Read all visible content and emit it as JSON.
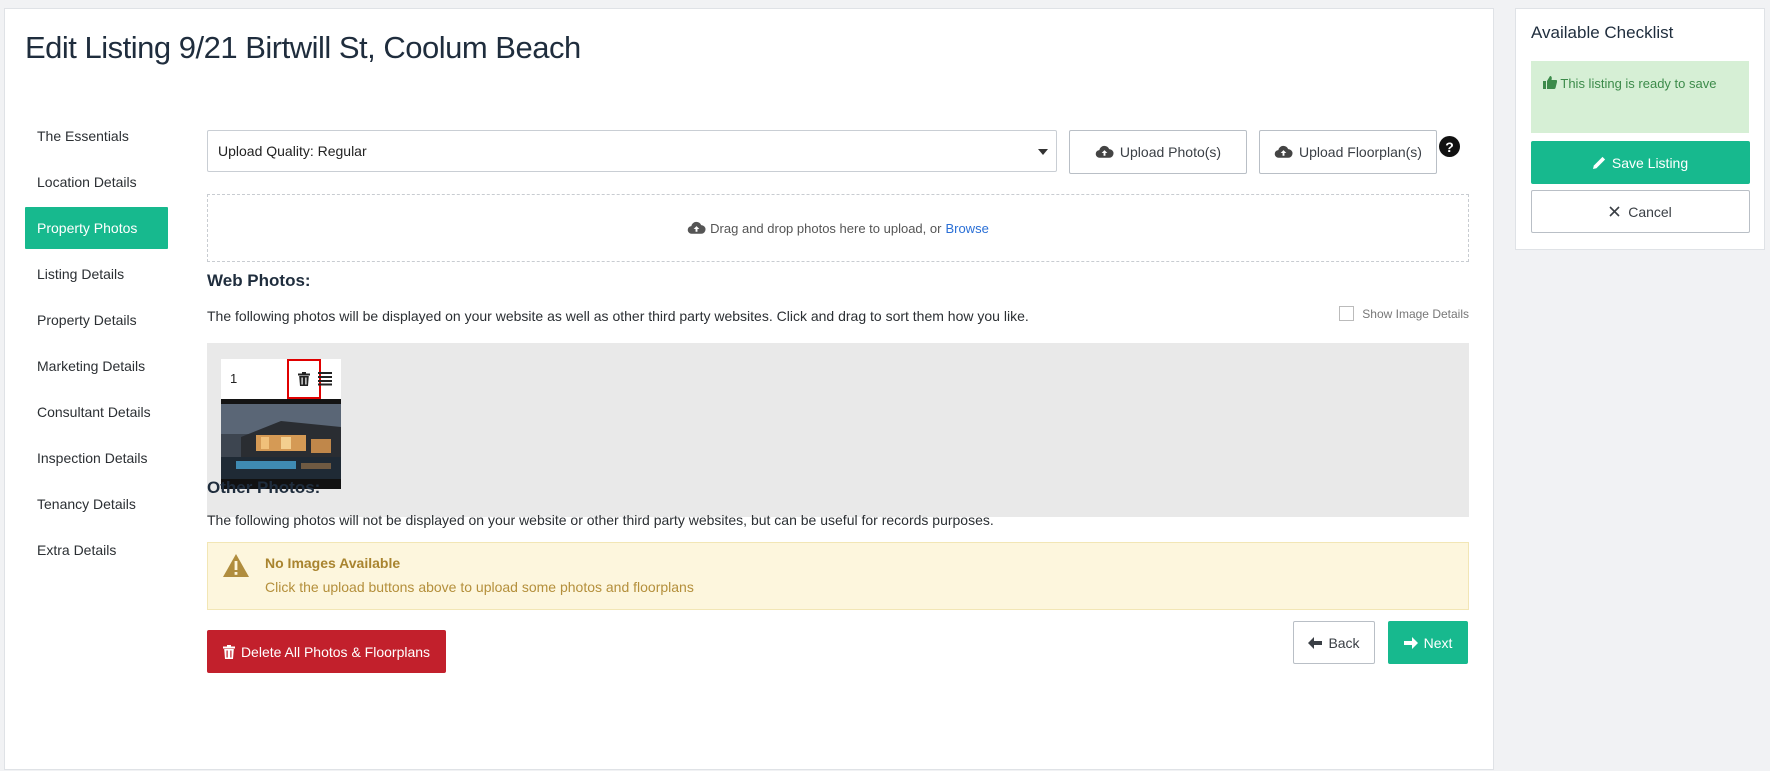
{
  "page": {
    "title": "Edit Listing 9/21 Birtwill St, Coolum Beach"
  },
  "sidebar": {
    "items": [
      {
        "label": "The Essentials"
      },
      {
        "label": "Location Details"
      },
      {
        "label": "Property Photos",
        "active": true
      },
      {
        "label": "Listing Details"
      },
      {
        "label": "Property Details"
      },
      {
        "label": "Marketing Details"
      },
      {
        "label": "Consultant Details"
      },
      {
        "label": "Inspection Details"
      },
      {
        "label": "Tenancy Details"
      },
      {
        "label": "Extra Details"
      }
    ]
  },
  "toolbar": {
    "quality_select": "Upload Quality: Regular",
    "upload_photos": "Upload Photo(s)",
    "upload_floorplans": "Upload Floorplan(s)",
    "help": "?"
  },
  "dropzone": {
    "text": "Drag and drop photos here to upload, or",
    "browse": "Browse"
  },
  "web_photos": {
    "title": "Web Photos:",
    "desc": "The following photos will be displayed on your website as well as other third party websites. Click and drag to sort them how you like.",
    "show_details": "Show Image Details",
    "photos": [
      {
        "number": "1"
      }
    ]
  },
  "other_photos": {
    "title": "Other Photos:",
    "desc": "The following photos will not be displayed on your website or other third party websites, but can be useful for records purposes.",
    "empty_title": "No Images Available",
    "empty_text": "Click the upload buttons above to upload some photos and floorplans"
  },
  "actions": {
    "delete_all": "Delete All Photos & Floorplans",
    "back": "Back",
    "next": "Next"
  },
  "checklist": {
    "title": "Available Checklist",
    "ready": "This listing is ready to save",
    "save": "Save Listing",
    "cancel": "Cancel"
  },
  "colors": {
    "accent": "#17b98e",
    "danger": "#c2202c",
    "warning_bg": "#fdf6dd",
    "success_bg": "#d6efd5"
  }
}
